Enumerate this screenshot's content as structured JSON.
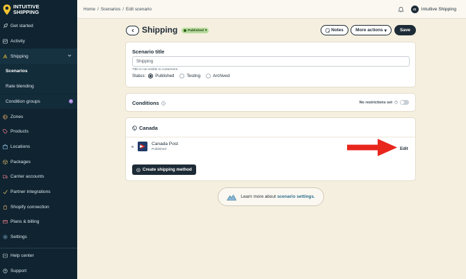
{
  "brand": {
    "line1": "INTUITIVE",
    "line2": "SHIPPING",
    "accent": "#f2c230"
  },
  "sidebar": {
    "items": [
      {
        "label": "Get started",
        "icon": "rocket-icon"
      },
      {
        "label": "Activity",
        "icon": "activity-icon"
      },
      {
        "label": "Shipping",
        "icon": "shipping-icon"
      },
      {
        "label": "Scenarios",
        "icon": ""
      },
      {
        "label": "Rate blending",
        "icon": ""
      },
      {
        "label": "Condition groups",
        "icon": "",
        "badge": "!"
      },
      {
        "label": "Zones",
        "icon": "zones-icon"
      },
      {
        "label": "Products",
        "icon": "tag-icon"
      },
      {
        "label": "Locations",
        "icon": "location-icon"
      },
      {
        "label": "Packages",
        "icon": "package-icon"
      },
      {
        "label": "Carrier accounts",
        "icon": "truck-icon"
      },
      {
        "label": "Partner integrations",
        "icon": "integration-icon"
      },
      {
        "label": "Shopify connection",
        "icon": "shopify-icon"
      },
      {
        "label": "Plans & billing",
        "icon": "billing-icon"
      },
      {
        "label": "Settings",
        "icon": "gear-icon"
      }
    ],
    "bottom": [
      {
        "label": "Help center",
        "icon": "help-icon"
      },
      {
        "label": "Support",
        "icon": "support-icon"
      }
    ]
  },
  "topbar": {
    "breadcrumb": [
      "Home",
      "Scenarios",
      "Edit scenario"
    ],
    "user_initials": "IS",
    "user_name": "Intuitive Shipping"
  },
  "header": {
    "title": "Shipping",
    "status_badge": "Published",
    "notes_label": "Notes",
    "more_actions_label": "More actions",
    "save_label": "Save"
  },
  "scenario": {
    "section_title": "Scenario title",
    "title_value": "Shipping",
    "hint": "Title is not visible to customers.",
    "status_label": "Status:",
    "status_options": [
      "Published",
      "Testing",
      "Archived"
    ],
    "selected_status": "Published"
  },
  "conditions": {
    "title": "Conditions",
    "restriction_label": "No restrictions set"
  },
  "zone": {
    "title": "Canada",
    "method_name": "Canada Post",
    "method_status": "Published",
    "edit_label": "Edit",
    "create_label": "Create shipping method"
  },
  "learn_more": {
    "text": "Learn more about",
    "link": "scenario settings."
  },
  "colors": {
    "sidebar_bg": "#0f2430",
    "page_bg": "#f5efe0",
    "arrow": "#e8261c",
    "dark": "#1d2b36",
    "published_badge": "#b5dc9b"
  }
}
